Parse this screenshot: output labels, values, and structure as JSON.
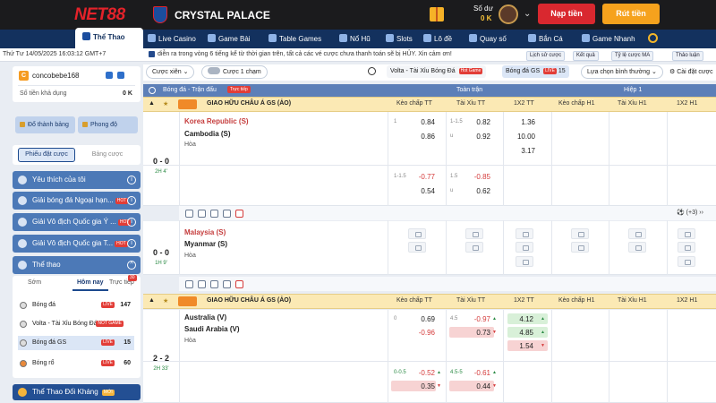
{
  "header": {
    "brand": "NET88",
    "partner": "CRYSTAL PALACE",
    "balance_label": "Số dư",
    "balance_value": "0 K",
    "deposit": "Nạp tiền",
    "withdraw": "Rút tiền"
  },
  "nav": {
    "items": [
      "Thể Thao",
      "Live Casino",
      "Game Bài",
      "Table Games",
      "Nổ Hũ",
      "Slots",
      "Lô đề",
      "Quay số",
      "Bắn Cá",
      "Game Nhanh"
    ]
  },
  "marquee": {
    "datetime": "Thứ Tư 14/05/2025 16:03:12 GMT+7",
    "text": "diễn ra trong vòng 6 tiếng kể từ thời gian trên, tất cả các vé cược chưa thanh toán sẽ bị HỦY. Xin cảm ơn!",
    "buttons": [
      "Lịch sử cược",
      "Kết quả",
      "Tỷ lệ cược MA",
      "Thảo luận"
    ]
  },
  "user": {
    "name": "concobebe168",
    "balance_label": "Số tiền khả dụng",
    "balance": "0 K",
    "btn_table": "Đổ thành bảng",
    "btn_mode": "Phong độ"
  },
  "betslip_tabs": [
    "Phiếu đặt cược",
    "Bảng cược"
  ],
  "sidebar": {
    "items": [
      "Yêu thích của tôi",
      "Giải bóng đá Ngoại hạn...",
      "Giải Vô địch Quốc gia Ý ...",
      "Giải Vô địch Quốc gia T..."
    ],
    "hot": "HOT",
    "sports_title": "Thể thao",
    "sport_tabs": [
      "Sớm",
      "Hôm nay",
      "Trực tiếp"
    ],
    "live_count": "30",
    "sports": [
      {
        "name": "Bóng đá",
        "tag": "LIVE",
        "count": "147"
      },
      {
        "name": "Volta - Tài Xỉu Bóng Đá",
        "tag": "NOT GAME",
        "count": ""
      },
      {
        "name": "Bóng đá GS",
        "tag": "LIVE",
        "count": "15"
      },
      {
        "name": "Bóng rổ",
        "tag": "LIVE",
        "count": "60"
      }
    ],
    "bottom": "Thể Thao Đối Kháng",
    "bottom_tag": "MỚI"
  },
  "filter": {
    "bet_type": "Cược xiên",
    "toggle": "Cược 1 chạm",
    "tab1": "Volta - Tài Xỉu Bóng Đá",
    "tab1_tag": "Hot Game",
    "tab2": "Bóng đá GS",
    "tab2_tag": "LIVE",
    "tab2_count": "15",
    "select": "Lựa chọn bình thường",
    "settings": "Cài đặt cược"
  },
  "table": {
    "sport": "Bóng đá - Trận đấu",
    "live_tag": "Trực tiếp",
    "full_time": "Toàn trận",
    "half1": "Hiệp 1",
    "cols": [
      "Kèo chấp TT",
      "Tài Xỉu TT",
      "1X2 TT",
      "Kèo chấp H1",
      "Tài Xỉu H1",
      "1X2 H1"
    ],
    "league": "GIAO HỮU CHÂU Á GS (ẢO)",
    "more": "(+3)"
  },
  "matches": [
    {
      "score": "0 - 0",
      "time": "2H 4'",
      "home": "Korea Republic (S)",
      "away": "Cambodia (S)",
      "draw": "Hòa",
      "lines": [
        {
          "hc_line": "1",
          "hc_home": "0.84",
          "hc_away": "0.86",
          "ou_line": "1-1.5",
          "ou_under": "u",
          "ou_over": "0.82",
          "ou_u": "0.92",
          "x1": "1.36",
          "x2": "10.00",
          "xd": "3.17"
        },
        {
          "hc_line": "1-1.5",
          "hc_home": "-0.77",
          "hc_away": "0.54",
          "ou_line": "1.5",
          "ou_under": "u",
          "ou_over": "-0.85",
          "ou_u": "0.62"
        }
      ]
    },
    {
      "score": "0 - 0",
      "time": "1H 9'",
      "home": "Malaysia (S)",
      "away": "Myanmar (S)",
      "draw": "Hòa"
    },
    {
      "score": "2 - 2",
      "time": "2H 33'",
      "home": "Australia (V)",
      "away": "Saudi Arabia (V)",
      "draw": "Hòa",
      "lines": [
        {
          "hc_line": "0",
          "hc_home": "0.69",
          "hc_away": "-0.96",
          "ou_line": "4.5",
          "ou_under": "u",
          "ou_over": "-0.97",
          "ou_u": "0.73",
          "x1": "4.12",
          "x2": "4.85",
          "xd": "1.54"
        },
        {
          "hc_line": "0-0.5",
          "hc_home": "-0.52",
          "hc_away": "0.35",
          "ou_line": "4.5-5",
          "ou_under": "u",
          "ou_over": "-0.61",
          "ou_u": "0.44"
        }
      ]
    }
  ],
  "colors": {
    "brand_red": "#e4222a",
    "nav_blue": "#13315e",
    "withdraw_orange": "#f6a21d",
    "league_yellow": "#fbe9b4"
  }
}
